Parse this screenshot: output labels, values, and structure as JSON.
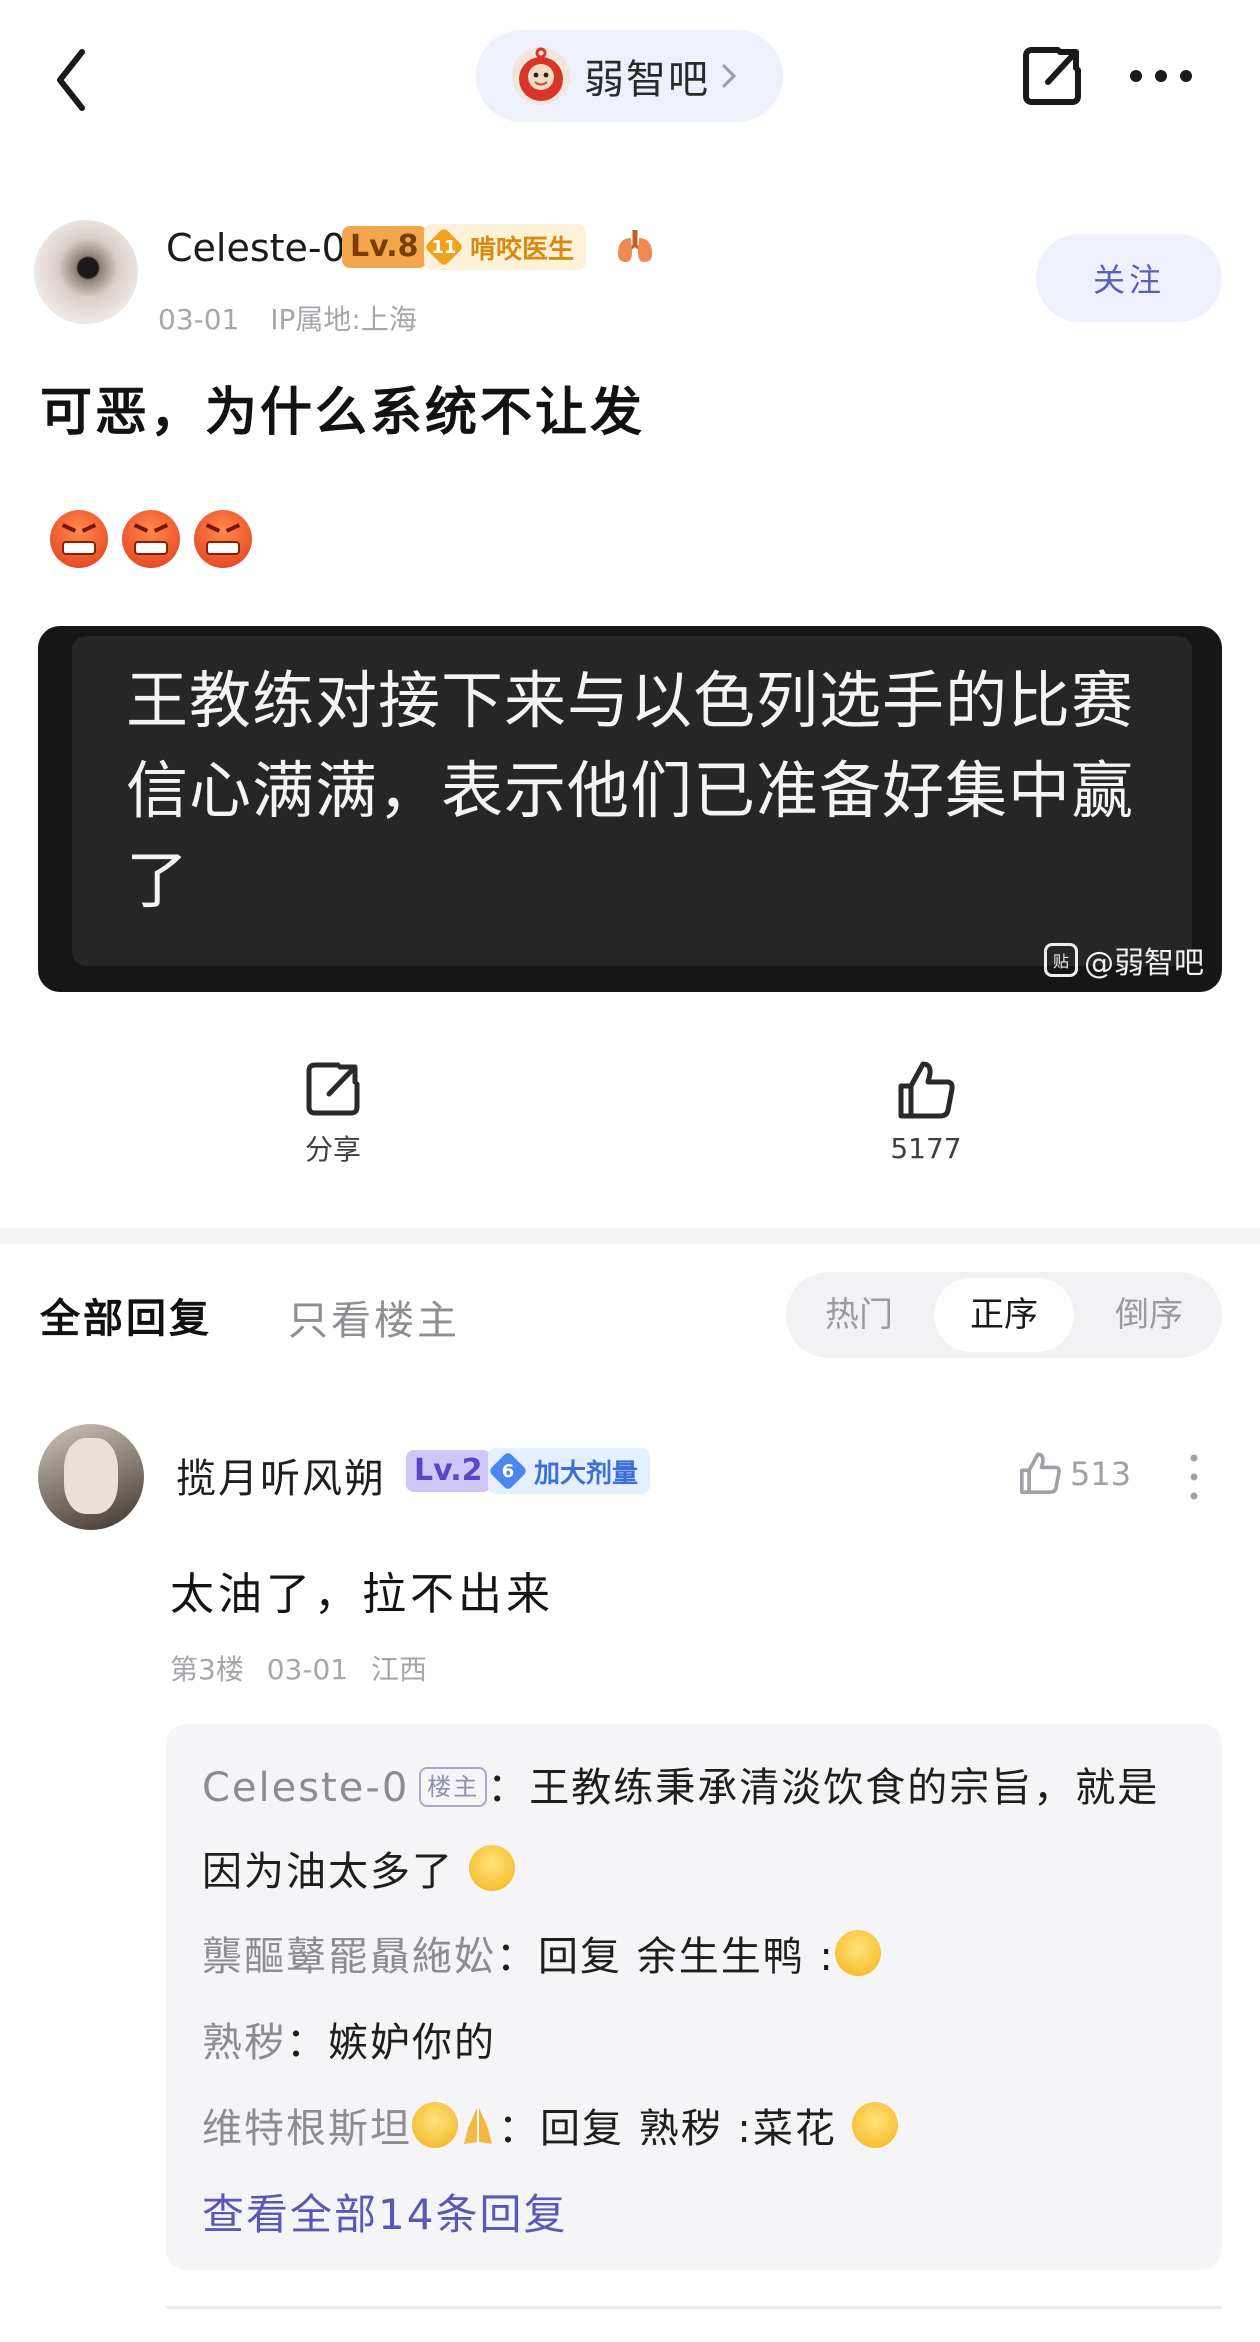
{
  "topbar": {
    "forum_name": "弱智吧"
  },
  "post": {
    "author": {
      "name": "Celeste-0",
      "level": "Lv.8",
      "title_rank": "11",
      "title": "啃咬医生",
      "date": "03-01",
      "ip": "IP属地:上海",
      "follow_label": "关注"
    },
    "title": "可恶，为什么系统不让发",
    "image": {
      "caption": "王教练对接下来与以色列选手的比赛信心满满，表示他们已准备好集中赢了",
      "watermark": "@弱智吧",
      "watermark_badge": "贴"
    },
    "actions": {
      "share_label": "分享",
      "like_count": "5177"
    }
  },
  "tabs": {
    "all_replies": "全部回复",
    "op_only": "只看楼主",
    "sort": [
      "热门",
      "正序",
      "倒序"
    ]
  },
  "reply": {
    "name": "揽月听风朔",
    "level": "Lv.2",
    "title_rank": "6",
    "title": "加大剂量",
    "like_count": "513",
    "text": "太油了，拉不出来",
    "meta": "第3楼 03-01 江西",
    "subreplies": [
      {
        "name": "Celeste-0",
        "op_tag": "楼主",
        "text": "：王教练秉承清淡饮食的宗旨，就是因为油太多了"
      },
      {
        "name": "龒醧鼙罷贔絁妐",
        "text": "：回复 余生生鸭 :"
      },
      {
        "name": "熟秽",
        "text": "：嫉妒你的"
      },
      {
        "name": "维特根斯坦",
        "text": "：回复 熟秽 :菜花"
      }
    ],
    "view_all": "查看全部14条回复"
  },
  "colors": {
    "accent": "#5a57b6",
    "pill_bg": "#eef0fb",
    "lv8": "#f3a64b",
    "lv2": "#cfc7f6"
  }
}
